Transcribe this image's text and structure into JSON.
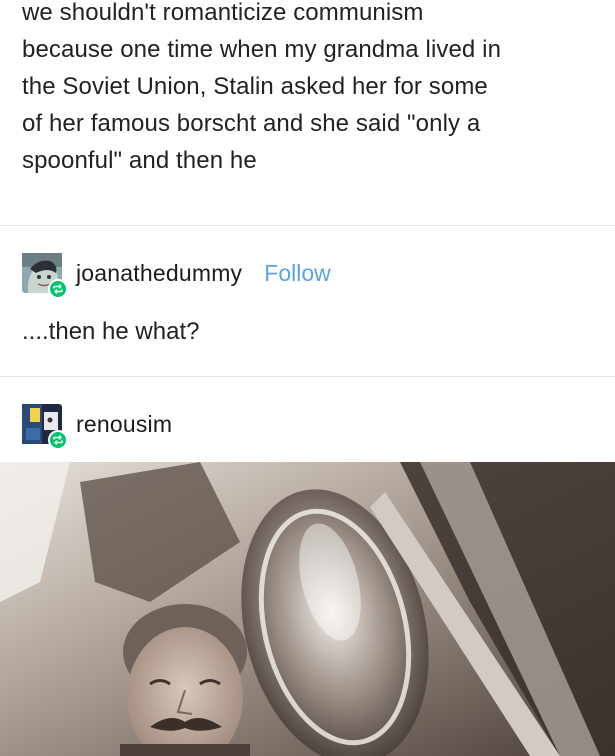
{
  "original_post": {
    "lines": [
      "we shouldn't romanticize communism",
      "because one time when my grandma lived in",
      "the Soviet Union, Stalin asked her for some",
      "of her famous borscht and she said \"only a",
      "spoonful\" and then he"
    ]
  },
  "reblog_1": {
    "username": "joanathedummy",
    "follow_label": "Follow",
    "text": "....then he what?",
    "avatar_icon": "user-avatar-icon",
    "badge_icon": "reblog-icon"
  },
  "reblog_2": {
    "username": "renousim",
    "avatar_icon": "user-avatar-icon",
    "badge_icon": "reblog-icon"
  },
  "colors": {
    "follow_link": "#5aa3e8",
    "reblog_badge": "#00c46a",
    "text": "#222222"
  }
}
